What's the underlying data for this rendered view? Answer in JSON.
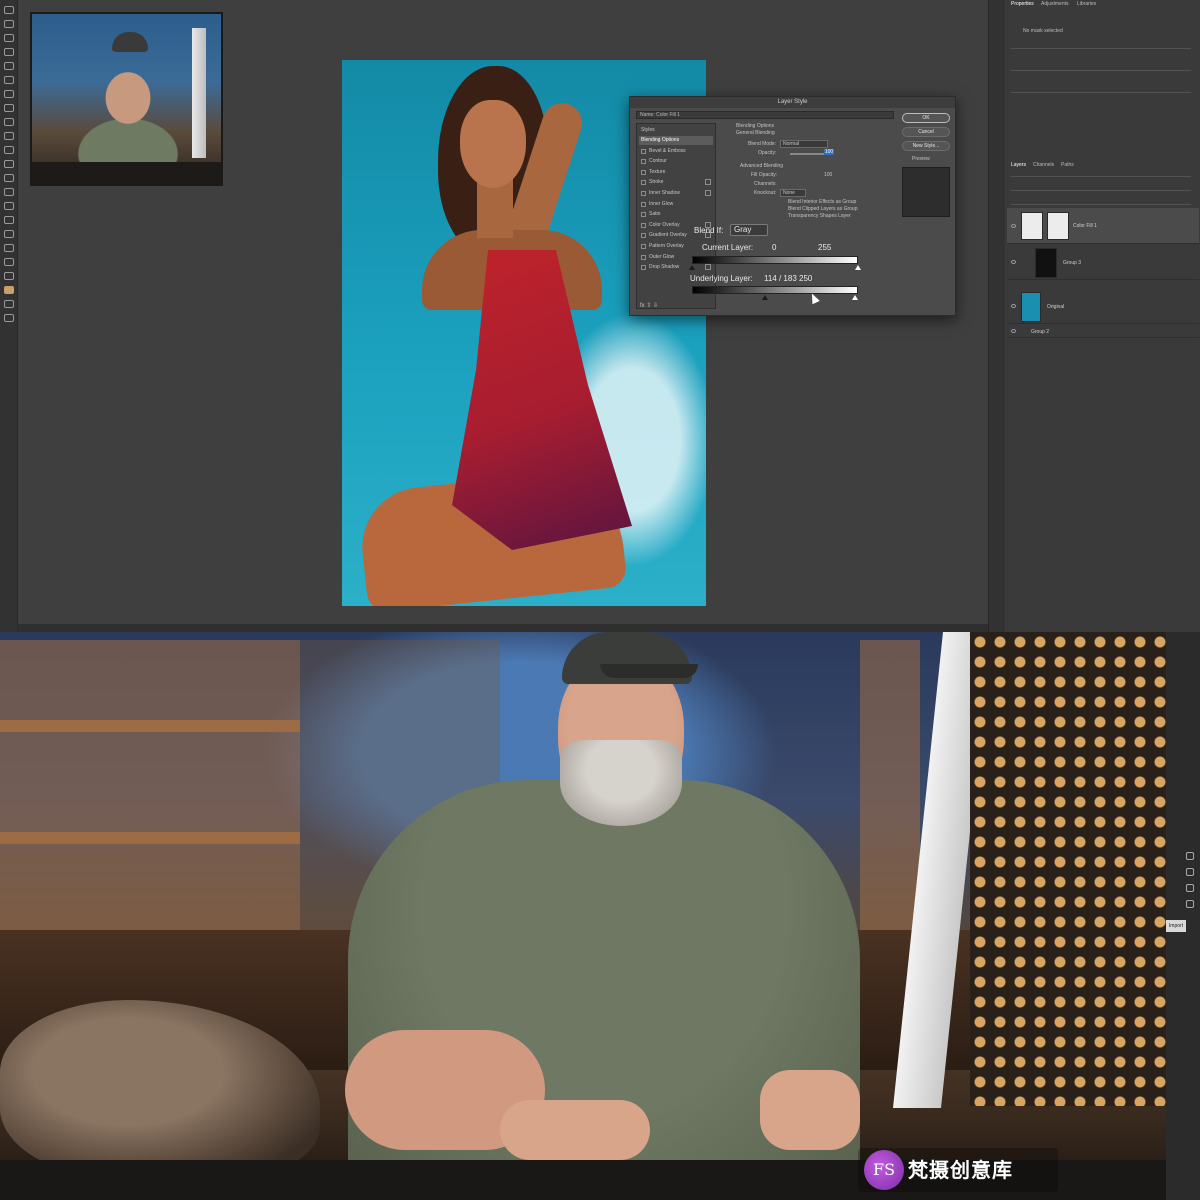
{
  "photoshop": {
    "dialog": {
      "title": "Layer Style",
      "name_field": "Name: Color Fill 1",
      "styles_header": "Styles",
      "styles": [
        {
          "label": "Blending Options",
          "active": true,
          "checkbox": false
        },
        {
          "label": "Bevel & Emboss",
          "checkbox": true
        },
        {
          "label": "Contour",
          "checkbox": true
        },
        {
          "label": "Texture",
          "checkbox": true
        },
        {
          "label": "Stroke",
          "checkbox": true,
          "plus": true
        },
        {
          "label": "Inner Shadow",
          "checkbox": true,
          "plus": true
        },
        {
          "label": "Inner Glow",
          "checkbox": true
        },
        {
          "label": "Satin",
          "checkbox": true
        },
        {
          "label": "Color Overlay",
          "checkbox": true,
          "plus": true
        },
        {
          "label": "Gradient Overlay",
          "checkbox": true,
          "plus": true
        },
        {
          "label": "Pattern Overlay",
          "checkbox": true
        },
        {
          "label": "Outer Glow",
          "checkbox": true
        },
        {
          "label": "Drop Shadow",
          "checkbox": true,
          "plus": true
        }
      ],
      "blending_options_heading": "Blending Options",
      "general_blending": "General Blending",
      "blend_mode_label": "Blend Mode:",
      "blend_mode_value": "Normal",
      "opacity_label": "Opacity:",
      "opacity_value": "100",
      "advanced_blending": "Advanced Blending",
      "fill_opacity_label": "Fill Opacity:",
      "fill_opacity_value": "100",
      "channels_label": "Channels:",
      "knockout_label": "Knockout:",
      "knockout_value": "None",
      "option_1": "Blend Interior Effects as Group",
      "option_2": "Blend Clipped Layers as Group",
      "option_3": "Transparency Shapes Layer",
      "blend_if_label": "Blend If:",
      "blend_if_value": "Gray",
      "current_layer_label": "Current Layer:",
      "current_layer_low": "0",
      "current_layer_high": "255",
      "underlying_layer_label": "Underlying Layer:",
      "underlying_layer_values": "114  /  183   250",
      "ok_label": "OK",
      "cancel_label": "Cancel",
      "new_style_label": "New Style...",
      "preview_label": "Preview"
    },
    "panels": {
      "properties_tab": "Properties",
      "adjustments_tab": "Adjustments",
      "libraries_tab": "Libraries",
      "no_mask": "No mask selected",
      "layers_tab": "Layers",
      "channels_tab": "Channels",
      "paths_tab": "Paths",
      "layers": [
        {
          "name": "Color Fill 1",
          "thumb_color": "#e8e8e8"
        },
        {
          "name": "Group 3",
          "thumb_color": "#111111"
        },
        {
          "name": "Original",
          "thumb_color": "#1a8fb0"
        },
        {
          "name": "Group 2",
          "thumb_color": ""
        }
      ]
    }
  },
  "watermark": {
    "logo_text": "FS",
    "text": "梵摄创意库"
  },
  "edge": {
    "tag": "Import"
  }
}
